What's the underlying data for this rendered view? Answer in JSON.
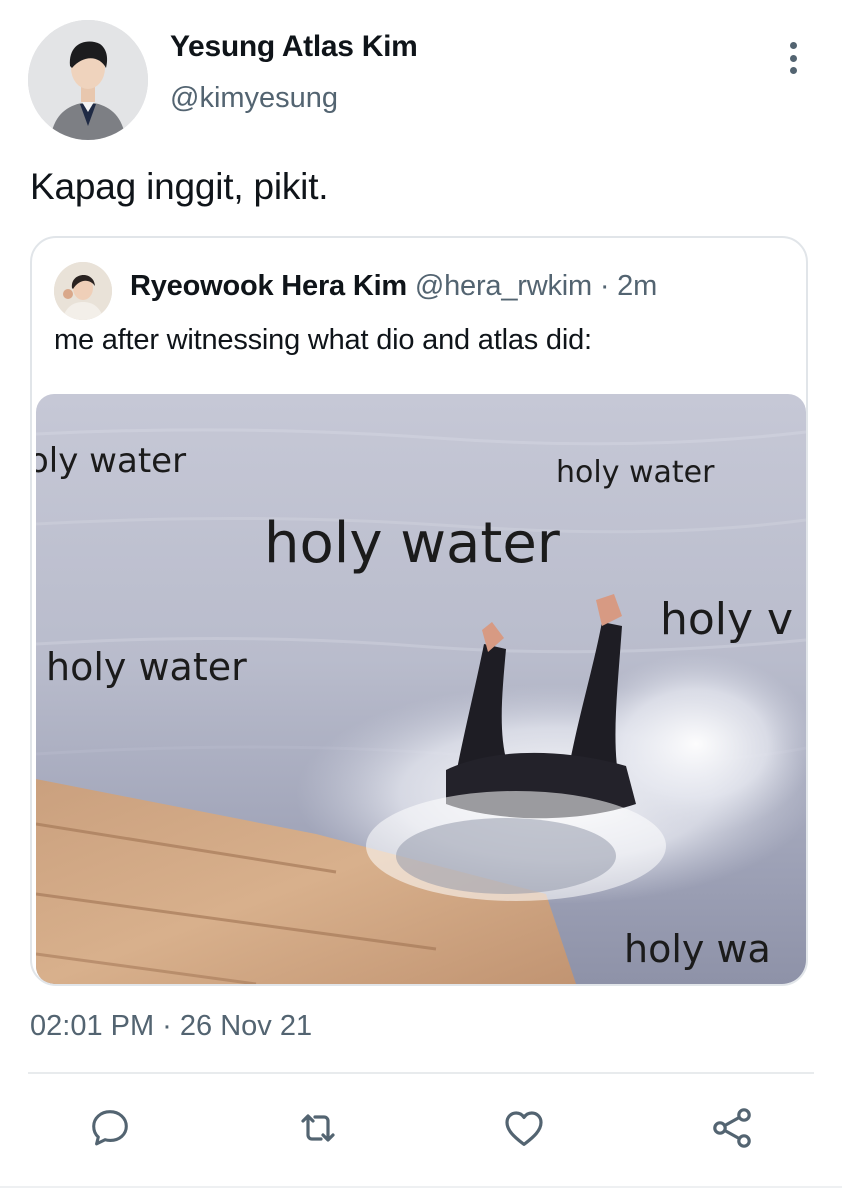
{
  "author": {
    "display_name": "Yesung Atlas Kim",
    "handle": "@kimyesung"
  },
  "tweet": {
    "text": "Kapag inggit, pikit.",
    "timestamp": "02:01 PM · 26 Nov 21"
  },
  "quoted": {
    "display_name": "Ryeowook Hera Kim",
    "handle": "@hera_rwkim",
    "separator": " · ",
    "time": "2m",
    "text": "me after witnessing what dio and atlas did:",
    "media_captions": [
      "oly water",
      "holy water",
      "holy water",
      "holy v",
      "holy water",
      "holy wa"
    ]
  },
  "icons": {
    "more": "more-vertical-icon",
    "reply": "reply-icon",
    "retweet": "retweet-icon",
    "like": "heart-icon",
    "share": "share-icon"
  },
  "colors": {
    "text_primary": "#0f1419",
    "text_secondary": "#536471",
    "border": "#e1e5e9",
    "icon": "#536471"
  }
}
